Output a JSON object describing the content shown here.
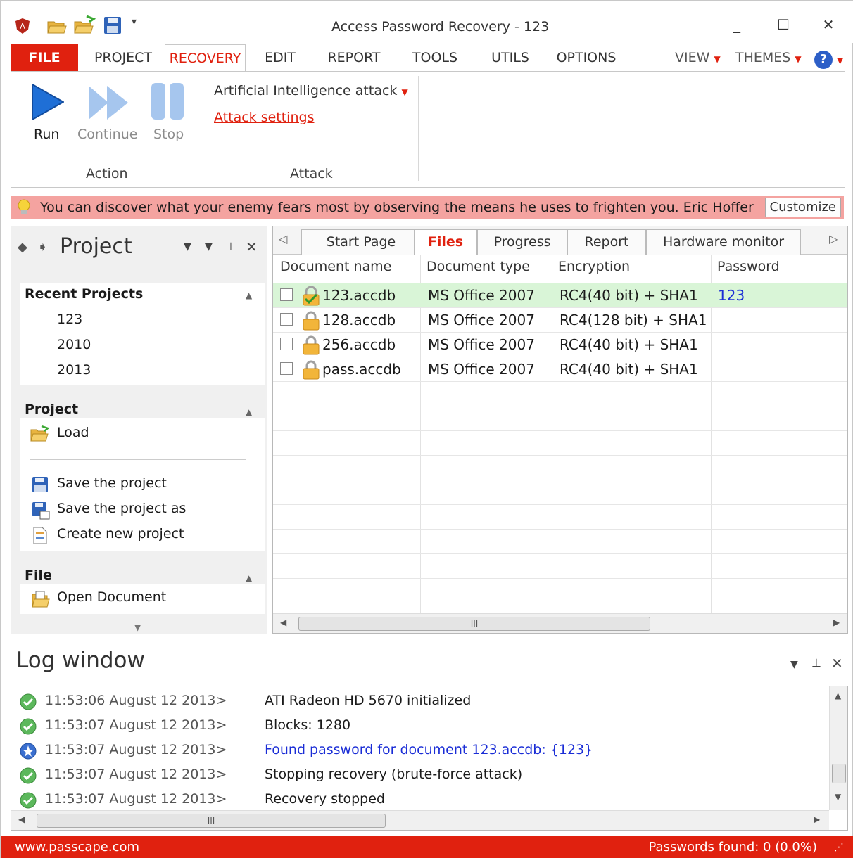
{
  "window": {
    "title": "Access Password Recovery - 123",
    "controls": {
      "minimize": "_",
      "maximize": "☐",
      "close": "✕"
    }
  },
  "ribbon_tabs": {
    "file": "FILE",
    "project": "PROJECT",
    "recovery": "RECOVERY",
    "edit": "EDIT",
    "report": "REPORT",
    "tools": "TOOLS",
    "utils": "UTILS",
    "options": "OPTIONS",
    "view": "VIEW",
    "themes": "THEMES",
    "help": "?"
  },
  "ribbon": {
    "action_group": "Action",
    "attack_group": "Attack",
    "run": "Run",
    "continue": "Continue",
    "stop": "Stop",
    "attack_type": "Artificial Intelligence attack",
    "attack_settings": "Attack settings"
  },
  "quote": {
    "text": "You can discover what your enemy fears most by observing the means he uses to frighten you. Eric Hoffer",
    "customize": "Customize"
  },
  "left_panel": {
    "title": "Project",
    "recent_header": "Recent Projects",
    "recent": [
      "123",
      "2010",
      "2013"
    ],
    "project_header": "Project",
    "load": "Load",
    "save": "Save the project",
    "save_as": "Save the project as",
    "create_new": "Create new project",
    "file_header": "File",
    "open_document": "Open Document"
  },
  "doc_tabs": {
    "start_page": "Start Page",
    "files": "Files",
    "progress": "Progress",
    "report": "Report",
    "hardware_monitor": "Hardware monitor"
  },
  "grid": {
    "headers": {
      "name": "Document name",
      "type": "Document type",
      "encryption": "Encryption",
      "password": "Password"
    },
    "rows": [
      {
        "name": "123.accdb",
        "type": "MS Office 2007",
        "encryption": "RC4(40 bit) + SHA1",
        "password": "123"
      },
      {
        "name": "128.accdb",
        "type": "MS Office 2007",
        "encryption": "RC4(128 bit) + SHA1",
        "password": ""
      },
      {
        "name": "256.accdb",
        "type": "MS Office 2007",
        "encryption": "RC4(40 bit) + SHA1",
        "password": ""
      },
      {
        "name": "pass.accdb",
        "type": "MS Office 2007",
        "encryption": "RC4(40 bit) + SHA1",
        "password": ""
      }
    ],
    "hscroll_grip": "III"
  },
  "log": {
    "title": "Log window",
    "entries": [
      {
        "time": "11:53:06 August 12 2013>",
        "message": "ATI Radeon HD 5670 initialized",
        "kind": "ok"
      },
      {
        "time": "11:53:07 August 12 2013>",
        "message": "Blocks: 1280",
        "kind": "ok"
      },
      {
        "time": "11:53:07 August 12 2013>",
        "message": "Found password for document 123.accdb: {123}",
        "kind": "found"
      },
      {
        "time": "11:53:07 August 12 2013>",
        "message": "Stopping recovery (brute-force attack)",
        "kind": "ok"
      },
      {
        "time": "11:53:07 August 12 2013>",
        "message": "Recovery stopped",
        "kind": "ok"
      }
    ],
    "hscroll_grip": "III"
  },
  "status": {
    "link": "www.passcape.com",
    "passwords_found": "Passwords found: 0 (0.0%)"
  },
  "colors": {
    "accent": "#e0210f",
    "quote_bg": "#f4a3a0",
    "found_row": "#d9f5d7",
    "link_blue": "#1a2dd6",
    "play_blue": "#1f6fd6"
  }
}
